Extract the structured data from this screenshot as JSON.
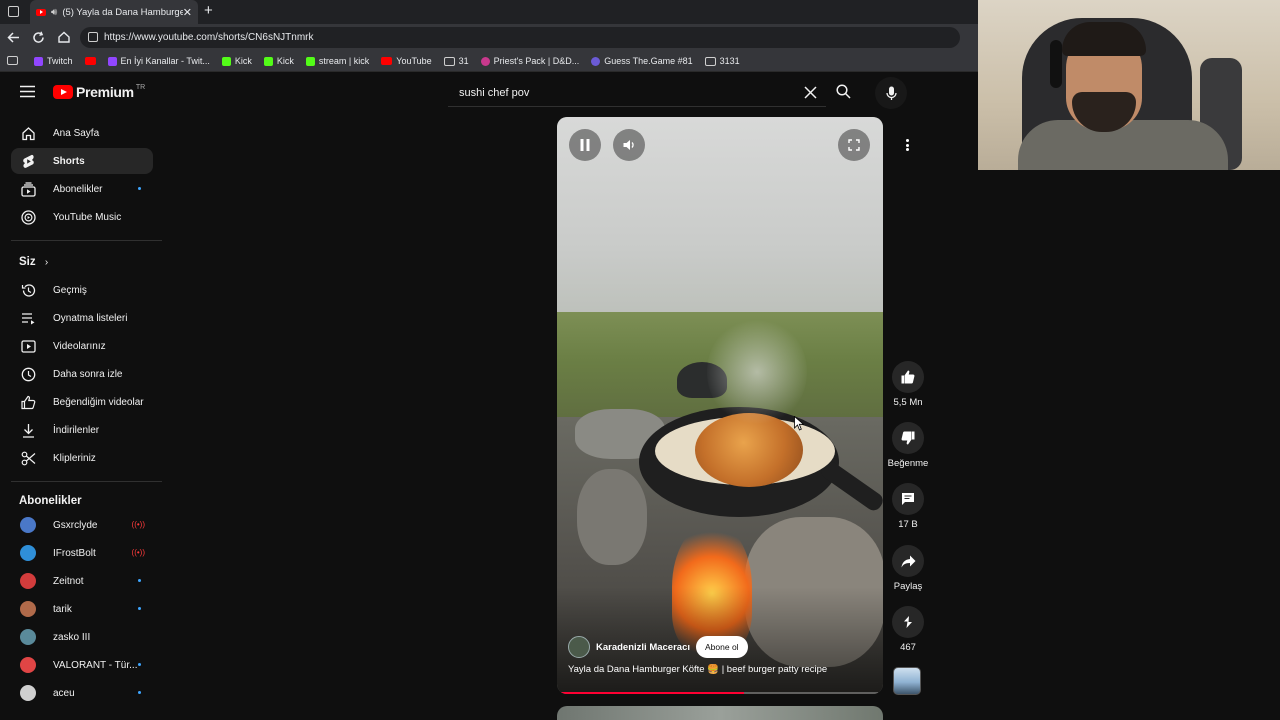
{
  "browser": {
    "tab_title": "(5) Yayla da Dana Hamburge",
    "url": "https://www.youtube.com/shorts/CN6sNJTnmrk",
    "bookmarks": [
      {
        "label": "Twitch",
        "icon": "twitch-icon",
        "color": "#9146ff"
      },
      {
        "label": "",
        "icon": "youtube-icon",
        "color": "#ff0000"
      },
      {
        "label": "En İyi Kanallar - Twit...",
        "icon": "twitch-icon",
        "color": "#9146ff"
      },
      {
        "label": "Kick",
        "icon": "kick-icon",
        "color": "#53fc18"
      },
      {
        "label": "Kick",
        "icon": "kick-icon",
        "color": "#53fc18"
      },
      {
        "label": "stream | kick",
        "icon": "kick-icon",
        "color": "#53fc18"
      },
      {
        "label": "YouTube",
        "icon": "youtube-icon",
        "color": "#ff0000"
      },
      {
        "label": "31",
        "icon": "folder-icon",
        "color": "#cccccc"
      },
      {
        "label": "Priest's Pack | D&D...",
        "icon": "dnd-icon",
        "color": "#c9398d"
      },
      {
        "label": "Guess The.Game #81",
        "icon": "game-icon",
        "color": "#6b5bd6"
      },
      {
        "label": "3131",
        "icon": "folder-icon",
        "color": "#cccccc"
      }
    ]
  },
  "header": {
    "logo_text": "Premium",
    "region": "TR",
    "search_value": "sushi chef pov"
  },
  "sidebar": {
    "main": [
      {
        "label": "Ana Sayfa",
        "icon": "home-icon",
        "active": false
      },
      {
        "label": "Shorts",
        "icon": "shorts-icon",
        "active": true
      },
      {
        "label": "Abonelikler",
        "icon": "subscriptions-icon",
        "active": false,
        "dot": true
      },
      {
        "label": "YouTube Music",
        "icon": "music-icon",
        "active": false
      }
    ],
    "you_title": "Siz",
    "you": [
      {
        "label": "Geçmiş",
        "icon": "history-icon"
      },
      {
        "label": "Oynatma listeleri",
        "icon": "playlists-icon"
      },
      {
        "label": "Videolarınız",
        "icon": "your-videos-icon"
      },
      {
        "label": "Daha sonra izle",
        "icon": "watch-later-icon"
      },
      {
        "label": "Beğendiğim videolar",
        "icon": "liked-icon"
      },
      {
        "label": "İndirilenler",
        "icon": "download-icon"
      },
      {
        "label": "Klipleriniz",
        "icon": "clips-icon"
      }
    ],
    "subs_title": "Abonelikler",
    "subs": [
      {
        "label": "Gsxrclyde",
        "status": "live",
        "color": "#4a78c8"
      },
      {
        "label": "IFrostBolt",
        "status": "live",
        "color": "#2f8fd8"
      },
      {
        "label": "Zeitnot",
        "status": "dot",
        "color": "#d23c3c"
      },
      {
        "label": "tarik",
        "status": "dot",
        "color": "#b06a4a"
      },
      {
        "label": "zasko III",
        "status": "none",
        "color": "#5a8a9a"
      },
      {
        "label": "VALORANT - Tür...",
        "status": "dot",
        "color": "#e04545"
      },
      {
        "label": "aceu",
        "status": "dot",
        "color": "#cfcfcf"
      }
    ]
  },
  "short": {
    "channel": "Karadenizli Maceracı",
    "subscribe_label": "Abone ol",
    "title": "Yayla da Dana Hamburger Köfte 🍔 | beef burger patty recipe",
    "progress": 0.58
  },
  "actions": {
    "likes": "5,5 Mn",
    "dislike_label": "Beğenme",
    "comments": "17 B",
    "share_label": "Paylaş",
    "remix": "467"
  }
}
